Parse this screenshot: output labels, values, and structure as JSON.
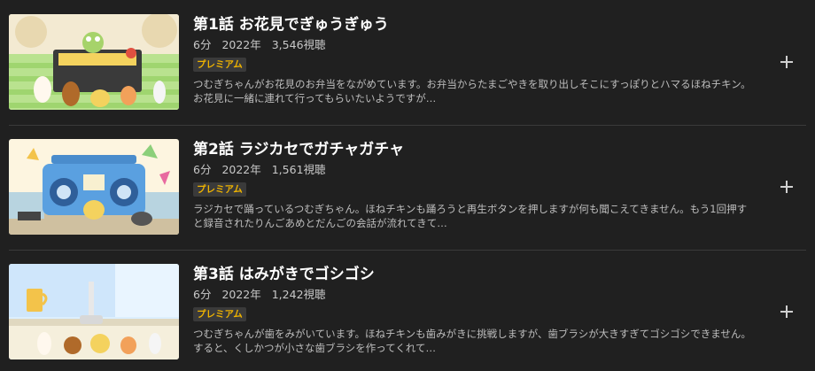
{
  "episodes": [
    {
      "title": "第1話 お花見でぎゅうぎゅう",
      "duration": "6分",
      "year": "2022年",
      "views": "3,546視聴",
      "badge": "プレミアム",
      "description": "つむぎちゃんがお花見のお弁当をながめています。お弁当からたまごやきを取り出しそこにすっぽりとハマるほねチキン。お花見に一緒に連れて行ってもらいたいようですが…"
    },
    {
      "title": "第2話 ラジカセでガチャガチャ",
      "duration": "6分",
      "year": "2022年",
      "views": "1,561視聴",
      "badge": "プレミアム",
      "description": "ラジカセで踊っているつむぎちゃん。ほねチキンも踊ろうと再生ボタンを押しますが何も聞こえてきません。もう1回押すと録音されたりんごあめとだんごの会話が流れてきて…"
    },
    {
      "title": "第3話 はみがきでゴシゴシ",
      "duration": "6分",
      "year": "2022年",
      "views": "1,242視聴",
      "badge": "プレミアム",
      "description": "つむぎちゃんが歯をみがいています。ほねチキンも歯みがきに挑戦しますが、歯ブラシが大きすぎてゴシゴシできません。すると、くしかつが小さな歯ブラシを作ってくれて…"
    }
  ],
  "colors": {
    "background": "#202020",
    "badge_text": "#f0b400",
    "badge_bg": "#3a3a3a"
  },
  "icons": {
    "add": "plus-icon"
  }
}
